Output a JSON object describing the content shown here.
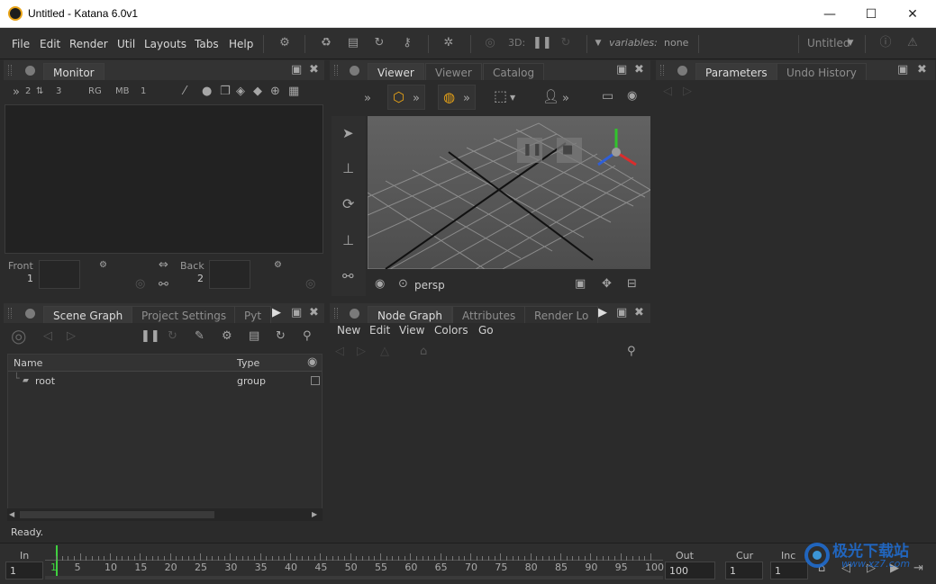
{
  "window": {
    "title": "Untitled - Katana 6.0v1",
    "minimize_glyph": "—",
    "maximize_glyph": "☐",
    "close_glyph": "✕"
  },
  "menubar": {
    "items": [
      "File",
      "Edit",
      "Render",
      "Util",
      "Layouts",
      "Tabs",
      "Help"
    ],
    "three_d_label": "3D:",
    "variables_label": "variables:",
    "variables_value": "none",
    "project_name": "Untitled"
  },
  "monitor": {
    "tab": "Monitor",
    "toolbar": {
      "ab1": "2",
      "ab2": "3",
      "r": "RG",
      "m": "MB",
      "one": "1"
    },
    "front_label": "Front",
    "front_value": "1",
    "back_label": "Back",
    "back_value": "2"
  },
  "viewer": {
    "tabs": [
      "Viewer",
      "Viewer",
      "Catalog"
    ],
    "camera": "persp"
  },
  "parameters": {
    "tabs": [
      "Parameters",
      "Undo History"
    ]
  },
  "scene_graph": {
    "tabs": [
      "Scene Graph",
      "Project Settings",
      "Pyt"
    ],
    "columns": [
      "Name",
      "Type"
    ],
    "rows": [
      {
        "name": "root",
        "type": "group"
      }
    ]
  },
  "node_graph": {
    "tabs": [
      "Node Graph",
      "Attributes",
      "Render Lo"
    ],
    "menu": [
      "New",
      "Edit",
      "View",
      "Colors",
      "Go"
    ]
  },
  "status": {
    "text": "Ready."
  },
  "timeline": {
    "in_label": "In",
    "in_value": "1",
    "out_label": "Out",
    "out_value": "100",
    "cur_label": "Cur",
    "cur_value": "1",
    "inc_label": "Inc",
    "inc_value": "1",
    "ticks": [
      "1",
      "5",
      "10",
      "15",
      "20",
      "25",
      "30",
      "35",
      "40",
      "45",
      "50",
      "55",
      "60",
      "65",
      "70",
      "75",
      "80",
      "85",
      "90",
      "95",
      "100"
    ],
    "watermark": "极光下载站",
    "watermark_url": "www.xz7.com"
  },
  "colors": {
    "accent": "#e8a317",
    "current_frame": "#3fd13f",
    "panel_bg": "#2b2b2b"
  }
}
